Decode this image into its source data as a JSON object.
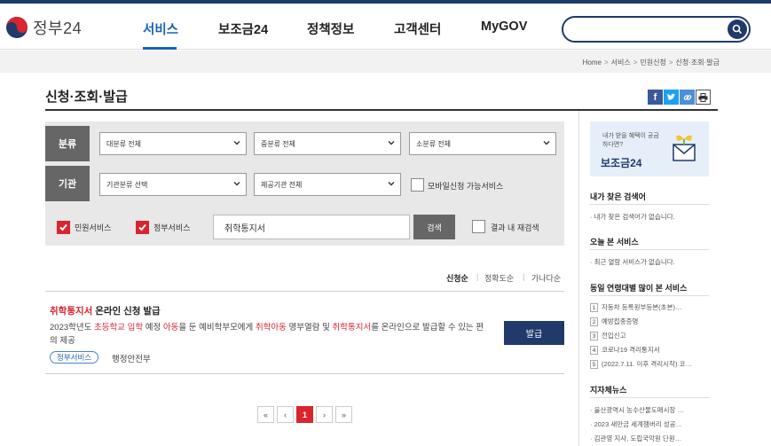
{
  "header": {
    "logo_text": "정부24",
    "nav": [
      "서비스",
      "보조금24",
      "정책정보",
      "고객센터",
      "MyGOV"
    ],
    "active_nav": "서비스",
    "search_value": "",
    "colors": {
      "brand": "#1f3a6b",
      "accent": "#1763b5",
      "highlight": "#d9252d"
    }
  },
  "breadcrumb": [
    "Home",
    "서비스",
    "민원신청",
    "신청·조회·발급"
  ],
  "page_title": "신청·조회·발급",
  "share_icons": [
    "facebook-icon",
    "twitter-icon",
    "link-icon",
    "print-icon"
  ],
  "filter": {
    "category_label": "분류",
    "org_label": "기관",
    "major_category": "대분류 전체",
    "middle_category": "중분류 전체",
    "minor_category": "소분류 전체",
    "org_type": "기관분류 선택",
    "provider_org": "제공기관 전체",
    "mobile_label": "모바일신청 가능서비스",
    "mobile_checked": false,
    "civil_label": "민원서비스",
    "civil_checked": true,
    "gov_label": "정부서비스",
    "gov_checked": true,
    "keyword": "취학통지서",
    "search_button": "검색",
    "research_label": "결과 내 재검색",
    "research_checked": false
  },
  "sort": {
    "options": [
      "신청순",
      "정확도순",
      "가나다순"
    ],
    "active": "신청순"
  },
  "result": {
    "title_highlight": "취학통지서",
    "title_rest": " 온라인 신청 발급",
    "desc_1": "2023학년도 ",
    "desc_hl_1": "초등학교 입학",
    "desc_2": " 예정 ",
    "desc_hl_2": "아동",
    "desc_3": "을 둔 예비학부모에게 ",
    "desc_hl_3": "취학아동",
    "desc_4": " 명부열람 및 ",
    "desc_hl_4": "취학통지서",
    "desc_5": "를 온라인으로 발급할 수 있는 편의 제공",
    "tag": "정부서비스",
    "org": "행정안전부",
    "button": "발급"
  },
  "pagination": {
    "first": "«",
    "prev": "‹",
    "current": "1",
    "next": "›",
    "last": "»"
  },
  "sidebar": {
    "banner_sub": "내가 받을 혜택이 궁금하다면?",
    "banner_title": "보조금24",
    "my_search_title": "내가 찾은 검색어",
    "my_search_empty": "· 내가 찾은 검색어가 없습니다.",
    "today_title": "오늘 본 서비스",
    "today_empty": "· 최근 열람 서비스가 없습니다.",
    "popular_title": "동일 연령대별 많이 본 서비스",
    "popular": [
      {
        "n": "1",
        "text": "자동차 등록원부등본(초본)…"
      },
      {
        "n": "2",
        "text": "예방접종증명"
      },
      {
        "n": "3",
        "text": "전입신고"
      },
      {
        "n": "4",
        "text": "코로나19 격리통지서"
      },
      {
        "n": "5",
        "text": "(2022.7.11. 이후 격리시작) 코…"
      }
    ],
    "news_title": "지자체뉴스",
    "news": [
      "· 울산광역시 농수산물도매시장 …",
      "· 2023 새만금 세계잼버리 성공…",
      "· 김관영 지사, 도립국악원 단원…"
    ]
  }
}
